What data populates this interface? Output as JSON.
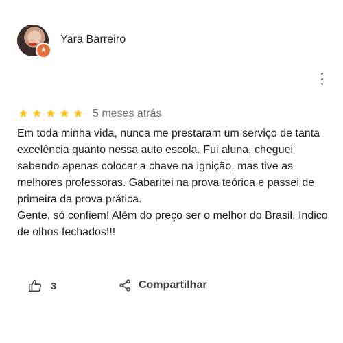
{
  "reviewer": {
    "name": "Yara Barreiro",
    "badge_icon": "local-guide-star-icon"
  },
  "menu": {
    "icon": "more-vert-icon"
  },
  "rating": {
    "stars": 5,
    "star_color": "#fbbc04",
    "date": "5 meses atrás"
  },
  "review": {
    "text": "Em toda minha vida, nunca me prestaram um serviço de tanta excelência quanto nessa auto escola. Fui aluna, cheguei sabendo apenas colocar a chave na ignição, mas tive as melhores professoras. Gabaritei na prova teórica e passei de primeira da prova prática.\nGente, só confiem! Além do preço ser o melhor do Brasil. Indico de olhos fechados!!!"
  },
  "actions": {
    "like_icon": "thumbs-up-icon",
    "like_count": "3",
    "share_icon": "share-icon",
    "share_label": "Compartilhar"
  }
}
